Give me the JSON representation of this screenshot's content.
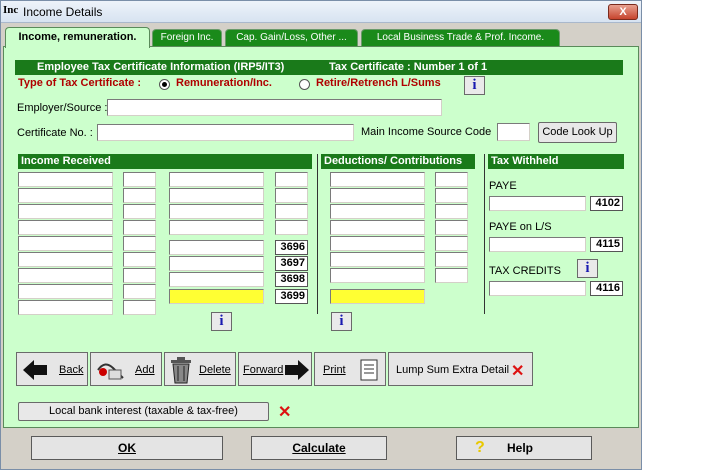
{
  "window": {
    "app_icon": "Inc",
    "title": "Income Details",
    "close_label": "X"
  },
  "tabs": [
    {
      "label": "Income, remuneration."
    },
    {
      "label": "Foreign Inc."
    },
    {
      "label": "Cap. Gain/Loss, Other ..."
    },
    {
      "label": "Local Business Trade & Prof. Income."
    }
  ],
  "certificate": {
    "header_left": "Employee Tax Certificate Information (IRP5/IT3)",
    "header_right": "Tax Certificate :  Number 1 of 1",
    "type_label": "Type of Tax Certificate :",
    "option_remuneration": "Remuneration/Inc.",
    "option_retire": "Retire/Retrench L/Sums",
    "selected": "Remuneration/Inc.",
    "employer_label": "Employer/Source :",
    "employer_value": "",
    "cert_no_label": "Certificate  No. :",
    "cert_no_value": "",
    "main_code_label": "Main Income Source Code",
    "main_code_value": "",
    "code_lookup_label": "Code Look Up"
  },
  "income": {
    "header": "Income Received",
    "codes": [
      "3696",
      "3697",
      "3698",
      "3699"
    ]
  },
  "deductions": {
    "header": "Deductions/ Contributions"
  },
  "tax": {
    "header": "Tax Withheld",
    "paye_label": "PAYE",
    "paye_code": "4102",
    "paye_ls_label": "PAYE on L/S",
    "paye_ls_code": "4115",
    "credits_label": "TAX CREDITS",
    "credits_code": "4116"
  },
  "toolbar": {
    "back": "Back",
    "add": "Add",
    "delete": "Delete",
    "forward": "Forward",
    "print": "Print",
    "lump_sum": "Lump Sum Extra Detail"
  },
  "bank_interest_label": "Local bank interest (taxable & tax-free)",
  "buttons": {
    "ok": "OK",
    "calculate": "Calculate",
    "help": "Help"
  },
  "colors": {
    "panel": "#ccffcc",
    "header": "#1a7a1a",
    "highlight": "#ffff33",
    "accent_red": "#cc0000"
  }
}
